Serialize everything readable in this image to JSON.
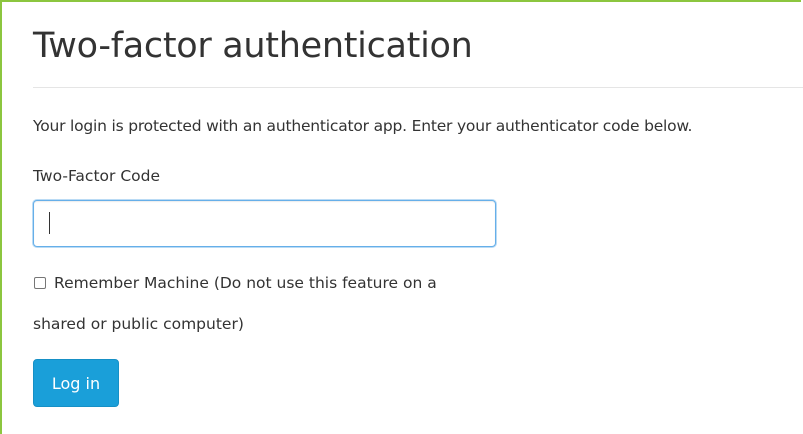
{
  "page": {
    "title": "Two-factor authentication",
    "description": "Your login is protected with an authenticator app. Enter your authenticator code below."
  },
  "form": {
    "code_label": "Two-Factor Code",
    "code_value": "",
    "remember_label_line1": "Remember Machine (Do not use this feature on a",
    "remember_label_line2": "shared or public computer)",
    "remember_checked": false,
    "login_label": "Log in"
  },
  "colors": {
    "frame_border": "#8cc63f",
    "input_focus": "#66afe9",
    "button_bg": "#1a9fd9",
    "button_text": "#ffffff"
  }
}
